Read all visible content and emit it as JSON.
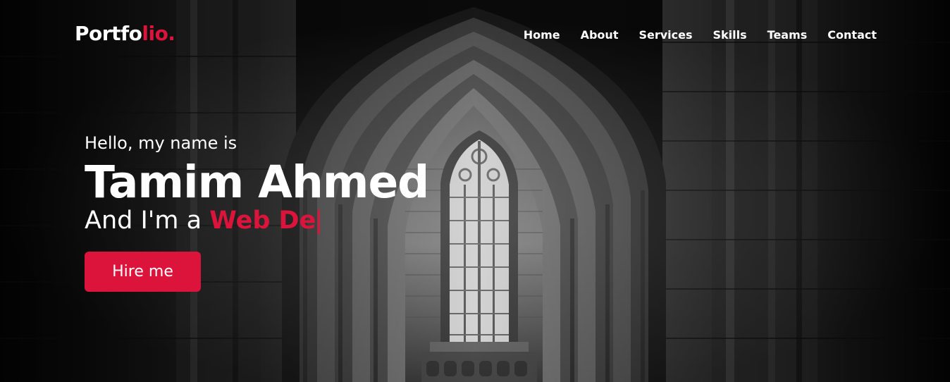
{
  "brand": {
    "logo_main": "Portfo",
    "logo_accent": "lio."
  },
  "nav": {
    "items": [
      {
        "label": "Home"
      },
      {
        "label": "About"
      },
      {
        "label": "Services"
      },
      {
        "label": "Skills"
      },
      {
        "label": "Teams"
      },
      {
        "label": "Contact"
      }
    ]
  },
  "hero": {
    "greeting": "Hello, my name is",
    "name": "Tamim Ahmed",
    "role_prefix": "And I'm a ",
    "role_typed": "Web De",
    "cursor": "|",
    "cta_label": "Hire me"
  },
  "colors": {
    "accent": "#dc143c",
    "text": "#ffffff",
    "background": "#000000"
  },
  "icons": {
    "background": "gothic-cathedral-arch-photo"
  }
}
